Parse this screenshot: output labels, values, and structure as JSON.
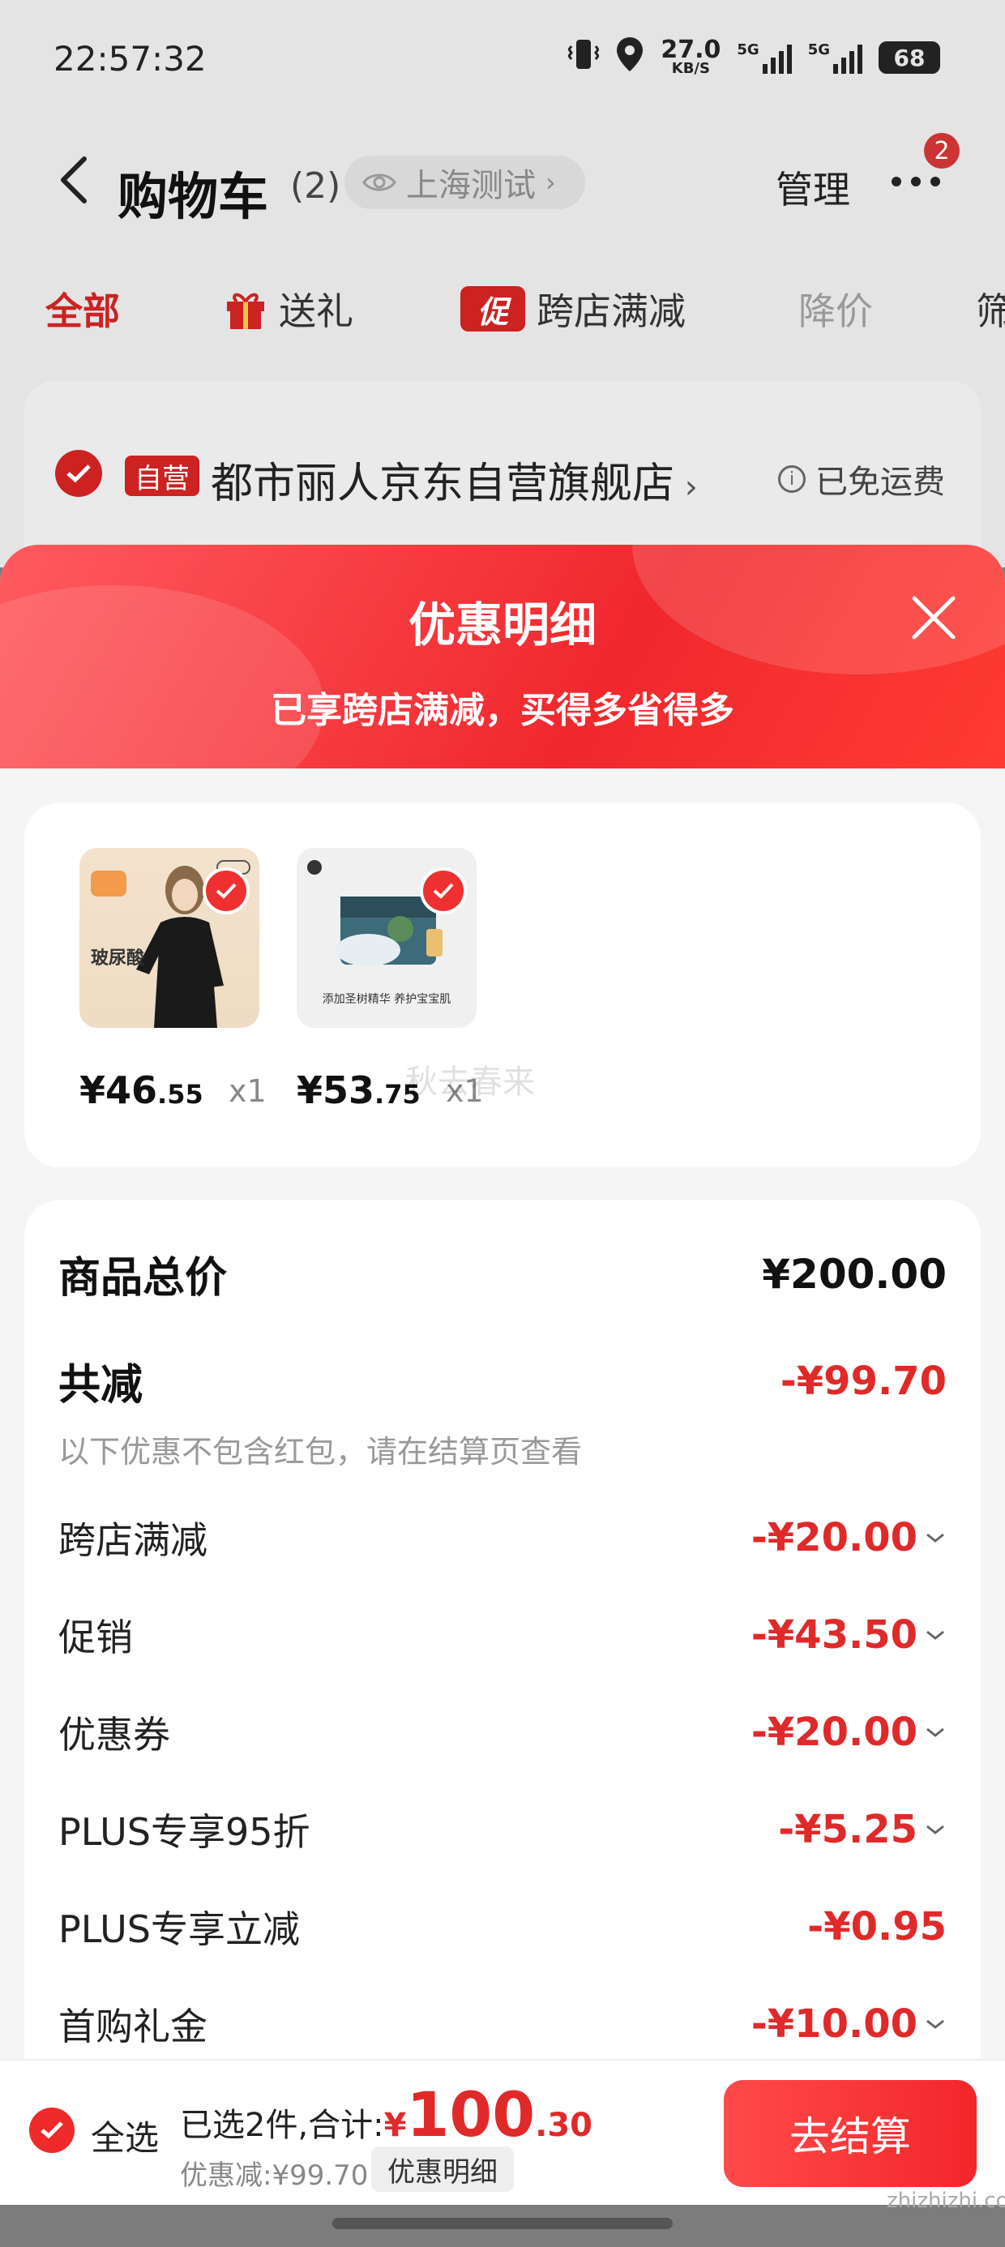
{
  "status_bar": {
    "time": "22:57:32",
    "speed_value": "27.0",
    "speed_unit": "KB/S",
    "signal1_label": "5G",
    "signal2_label": "5G",
    "battery": "68"
  },
  "nav": {
    "title": "购物车",
    "count": "(2)",
    "location": "上海测试",
    "manage_label": "管理",
    "more_badge": "2"
  },
  "filter_tabs": [
    {
      "label": "全部"
    },
    {
      "label": "送礼"
    },
    {
      "label": "跨店满减",
      "badge": "促"
    },
    {
      "label": "降价"
    },
    {
      "label": "筛"
    }
  ],
  "store": {
    "badge": "自营",
    "name": "都市丽人京东自营旗舰店",
    "shipping": "已免运费"
  },
  "sheet": {
    "title": "优惠明细",
    "subtitle": "已享跨店满减，买得多省得多"
  },
  "products": [
    {
      "price_currency": "¥",
      "price_int": "46",
      "price_dec": ".55",
      "qty": "x1",
      "thumb_text": "玻尿酸"
    },
    {
      "price_currency": "¥",
      "price_int": "53",
      "price_dec": ".75",
      "qty": "x1",
      "thumb_text": "添加圣树精华 养护宝宝肌"
    }
  ],
  "overlay_watermark": "秋去春来",
  "details": {
    "total_label": "商品总价",
    "total_value": "¥200.00",
    "reduced_label": "共减",
    "reduced_value": "-¥99.70",
    "note": "以下优惠不包含红包，请在结算页查看",
    "items": [
      {
        "label": "跨店满减",
        "value": "-¥20.00"
      },
      {
        "label": "促销",
        "value": "-¥43.50"
      },
      {
        "label": "优惠券",
        "value": "-¥20.00"
      },
      {
        "label": "PLUS专享95折",
        "value": "-¥5.25"
      },
      {
        "label": "PLUS专享立减",
        "value": "-¥0.95"
      },
      {
        "label": "首购礼金",
        "value": "-¥10.00"
      }
    ]
  },
  "checkout": {
    "select_all": "全选",
    "selected_label": "已选2件,合计:",
    "total_currency": "¥",
    "total_int": "100",
    "total_dec": ".30",
    "discount": "优惠减:¥99.70",
    "detail_button": "优惠明细",
    "checkout_button": "去结算"
  },
  "site_watermark": "zhizhizhi.com",
  "colors": {
    "accent": "#e02a2a",
    "header_gradient_start": "#ff5a5f",
    "header_gradient_end": "#f0282d"
  }
}
